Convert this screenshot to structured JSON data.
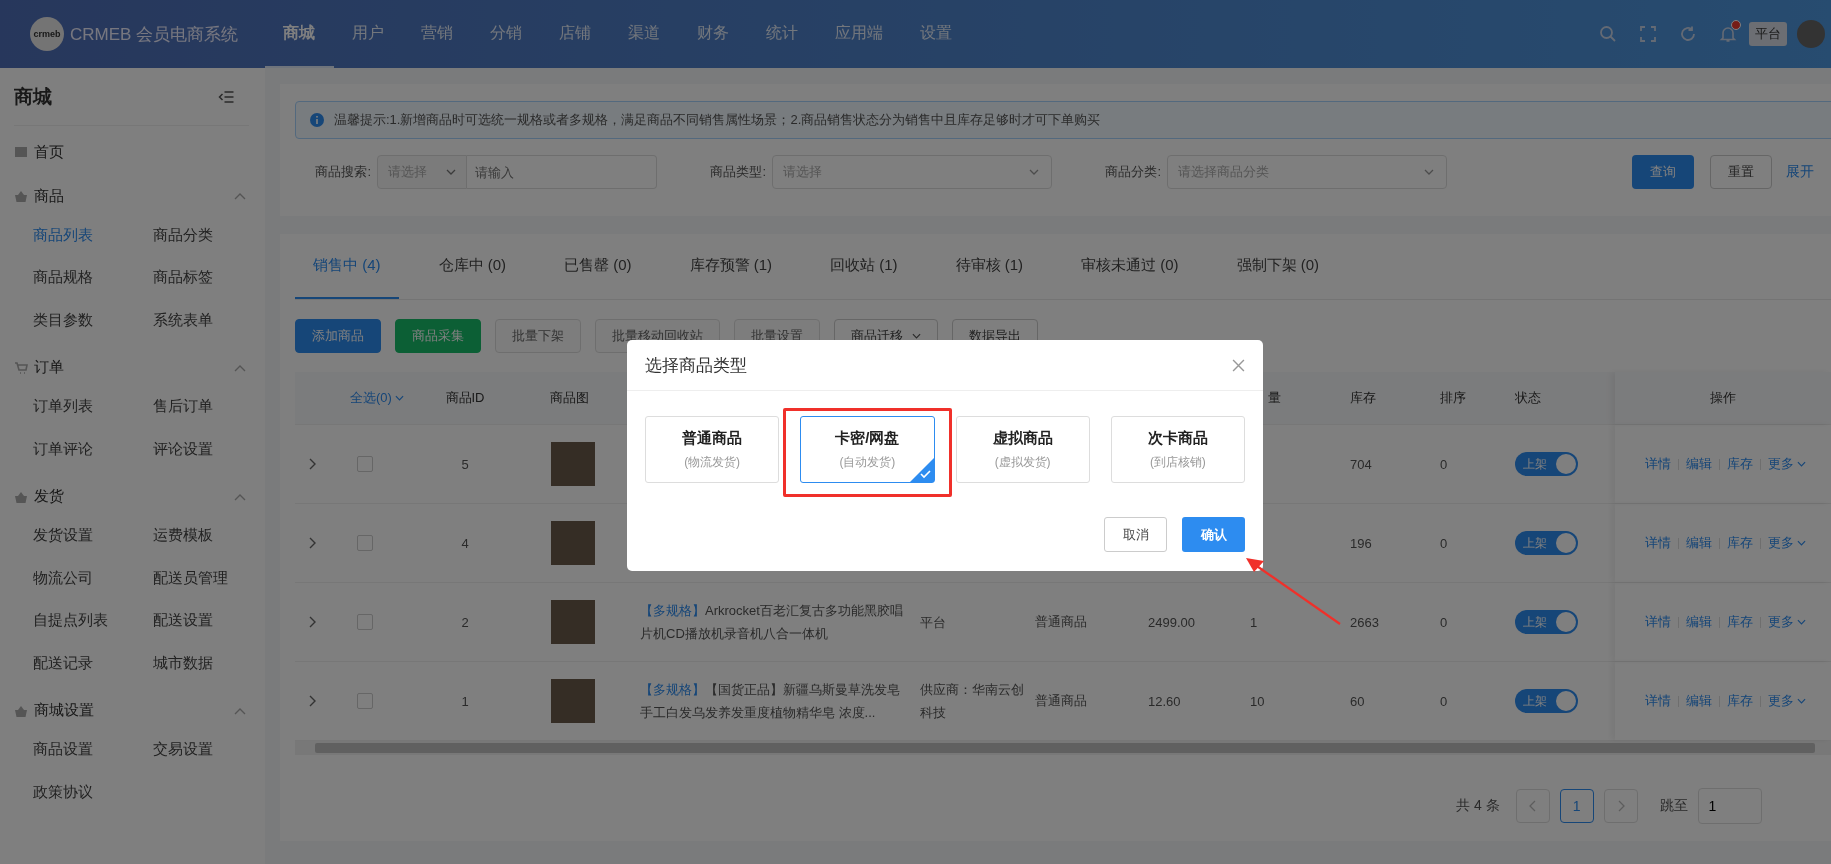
{
  "header": {
    "logo_mark": "crmeb",
    "brand": "CRMEB 会员电商系统",
    "nav": [
      {
        "label": "商城",
        "selected": true
      },
      {
        "label": "用户",
        "selected": false
      },
      {
        "label": "营销",
        "selected": false
      },
      {
        "label": "分销",
        "selected": false
      },
      {
        "label": "店铺",
        "selected": false
      },
      {
        "label": "渠道",
        "selected": false
      },
      {
        "label": "财务",
        "selected": false
      },
      {
        "label": "统计",
        "selected": false
      },
      {
        "label": "应用端",
        "selected": false
      },
      {
        "label": "设置",
        "selected": false
      }
    ],
    "unread": true,
    "role_badge": "平台"
  },
  "sidebar": {
    "title": "商城",
    "groups": [
      {
        "label": "首页",
        "kind": "link"
      },
      {
        "label": "商品",
        "kind": "group",
        "expanded": true,
        "items": [
          {
            "label": "商品列表",
            "selected": true
          },
          {
            "label": "商品分类",
            "selected": false
          },
          {
            "label": "商品规格",
            "selected": false
          },
          {
            "label": "商品标签",
            "selected": false
          },
          {
            "label": "类目参数",
            "selected": false
          },
          {
            "label": "系统表单",
            "selected": false
          }
        ]
      },
      {
        "label": "订单",
        "kind": "group",
        "expanded": true,
        "items": [
          {
            "label": "订单列表",
            "selected": false
          },
          {
            "label": "售后订单",
            "selected": false
          },
          {
            "label": "订单评论",
            "selected": false
          },
          {
            "label": "评论设置",
            "selected": false
          }
        ]
      },
      {
        "label": "发货",
        "kind": "group",
        "expanded": true,
        "items": [
          {
            "label": "发货设置",
            "selected": false
          },
          {
            "label": "运费模板",
            "selected": false
          },
          {
            "label": "物流公司",
            "selected": false
          },
          {
            "label": "配送员管理",
            "selected": false
          },
          {
            "label": "自提点列表",
            "selected": false
          },
          {
            "label": "配送设置",
            "selected": false
          },
          {
            "label": "配送记录",
            "selected": false
          },
          {
            "label": "城市数据",
            "selected": false
          }
        ]
      },
      {
        "label": "商城设置",
        "kind": "group",
        "expanded": true,
        "items": [
          {
            "label": "商品设置",
            "selected": false
          },
          {
            "label": "交易设置",
            "selected": false
          },
          {
            "label": "政策协议",
            "selected": false
          }
        ]
      }
    ]
  },
  "notice": "温馨提示:1.新增商品时可选统一规格或者多规格，满足商品不同销售属性场景；2.商品销售状态分为销售中且库存足够时才可下单购买",
  "filters": [
    {
      "label": "商品搜索:",
      "select_placeholder": "请选择",
      "placeholder": "请输入"
    },
    {
      "label": "商品类型:",
      "select_placeholder": "请选择"
    },
    {
      "label": "商品分类:",
      "select_placeholder": "请选择商品分类"
    }
  ],
  "filter_buttons": {
    "search": "查询",
    "reset": "重置",
    "expand": "展开"
  },
  "tabs": [
    {
      "label": "销售中 (4)",
      "selected": true
    },
    {
      "label": "仓库中 (0)",
      "selected": false
    },
    {
      "label": "已售罄 (0)",
      "selected": false
    },
    {
      "label": "库存预警 (1)",
      "selected": false
    },
    {
      "label": "回收站 (1)",
      "selected": false
    },
    {
      "label": "待审核 (1)",
      "selected": false
    },
    {
      "label": "审核未通过 (0)",
      "selected": false
    },
    {
      "label": "强制下架 (0)",
      "selected": false
    }
  ],
  "toolbar": [
    {
      "label": "添加商品",
      "kind": "primary"
    },
    {
      "label": "商品采集",
      "kind": "success"
    },
    {
      "label": "批量下架",
      "kind": "disabled"
    },
    {
      "label": "批量移动回收站",
      "kind": "disabled"
    },
    {
      "label": "批量设置",
      "kind": "disabled"
    },
    {
      "label": "商品迁移",
      "kind": "dropdown"
    },
    {
      "label": "数据导出",
      "kind": "default"
    }
  ],
  "table": {
    "header": {
      "select_all": "全选(0)",
      "id": "商品ID",
      "image": "商品图",
      "column_9": "量",
      "stock": "库存",
      "sort": "排序",
      "status": "状态",
      "actions": "操作"
    },
    "rows": [
      {
        "checked": false,
        "id": "5",
        "stock": "704",
        "sort": "0",
        "on": true,
        "status_label": "上架",
        "actions": [
          "详情",
          "编辑",
          "库存",
          "更多"
        ]
      },
      {
        "checked": false,
        "id": "4",
        "stock": "196",
        "sort": "0",
        "on": true,
        "status_label": "上架",
        "actions": [
          "详情",
          "编辑",
          "库存",
          "更多"
        ]
      },
      {
        "checked": false,
        "id": "2",
        "tag": "【多规格】",
        "name": "Arkrocket百老汇复古多功能黑胶唱片机CD播放机录音机八合一体机",
        "supplier": "平台",
        "type": "普通商品",
        "price": "2499.00",
        "sales": "1",
        "stock": "2663",
        "sort": "0",
        "on": true,
        "status_label": "上架",
        "actions": [
          "详情",
          "编辑",
          "库存",
          "更多"
        ]
      },
      {
        "checked": false,
        "id": "1",
        "tag": "【多规格】",
        "name": "【国货正品】新疆乌斯曼草洗发皂手工白发乌发养发重度植物精华皂 浓度...",
        "supplier": "供应商：华南云创科技",
        "type": "普通商品",
        "price": "12.60",
        "sales": "10",
        "stock": "60",
        "sort": "0",
        "on": true,
        "status_label": "上架",
        "actions": [
          "详情",
          "编辑",
          "库存",
          "更多"
        ]
      }
    ]
  },
  "pagination": {
    "total": "共 4 条",
    "pages": [
      {
        "label": "1",
        "selected": true
      }
    ],
    "jump_label": "跳至",
    "jump_value": "1"
  },
  "modal": {
    "title": "选择商品类型",
    "options": [
      {
        "title": "普通商品",
        "subtitle": "(物流发货)",
        "selected": false
      },
      {
        "title": "卡密/网盘",
        "subtitle": "(自动发货)",
        "selected": true
      },
      {
        "title": "虚拟商品",
        "subtitle": "(虚拟发货)",
        "selected": false
      },
      {
        "title": "次卡商品",
        "subtitle": "(到店核销)",
        "selected": false
      }
    ],
    "cancel": "取消",
    "confirm": "确认"
  }
}
